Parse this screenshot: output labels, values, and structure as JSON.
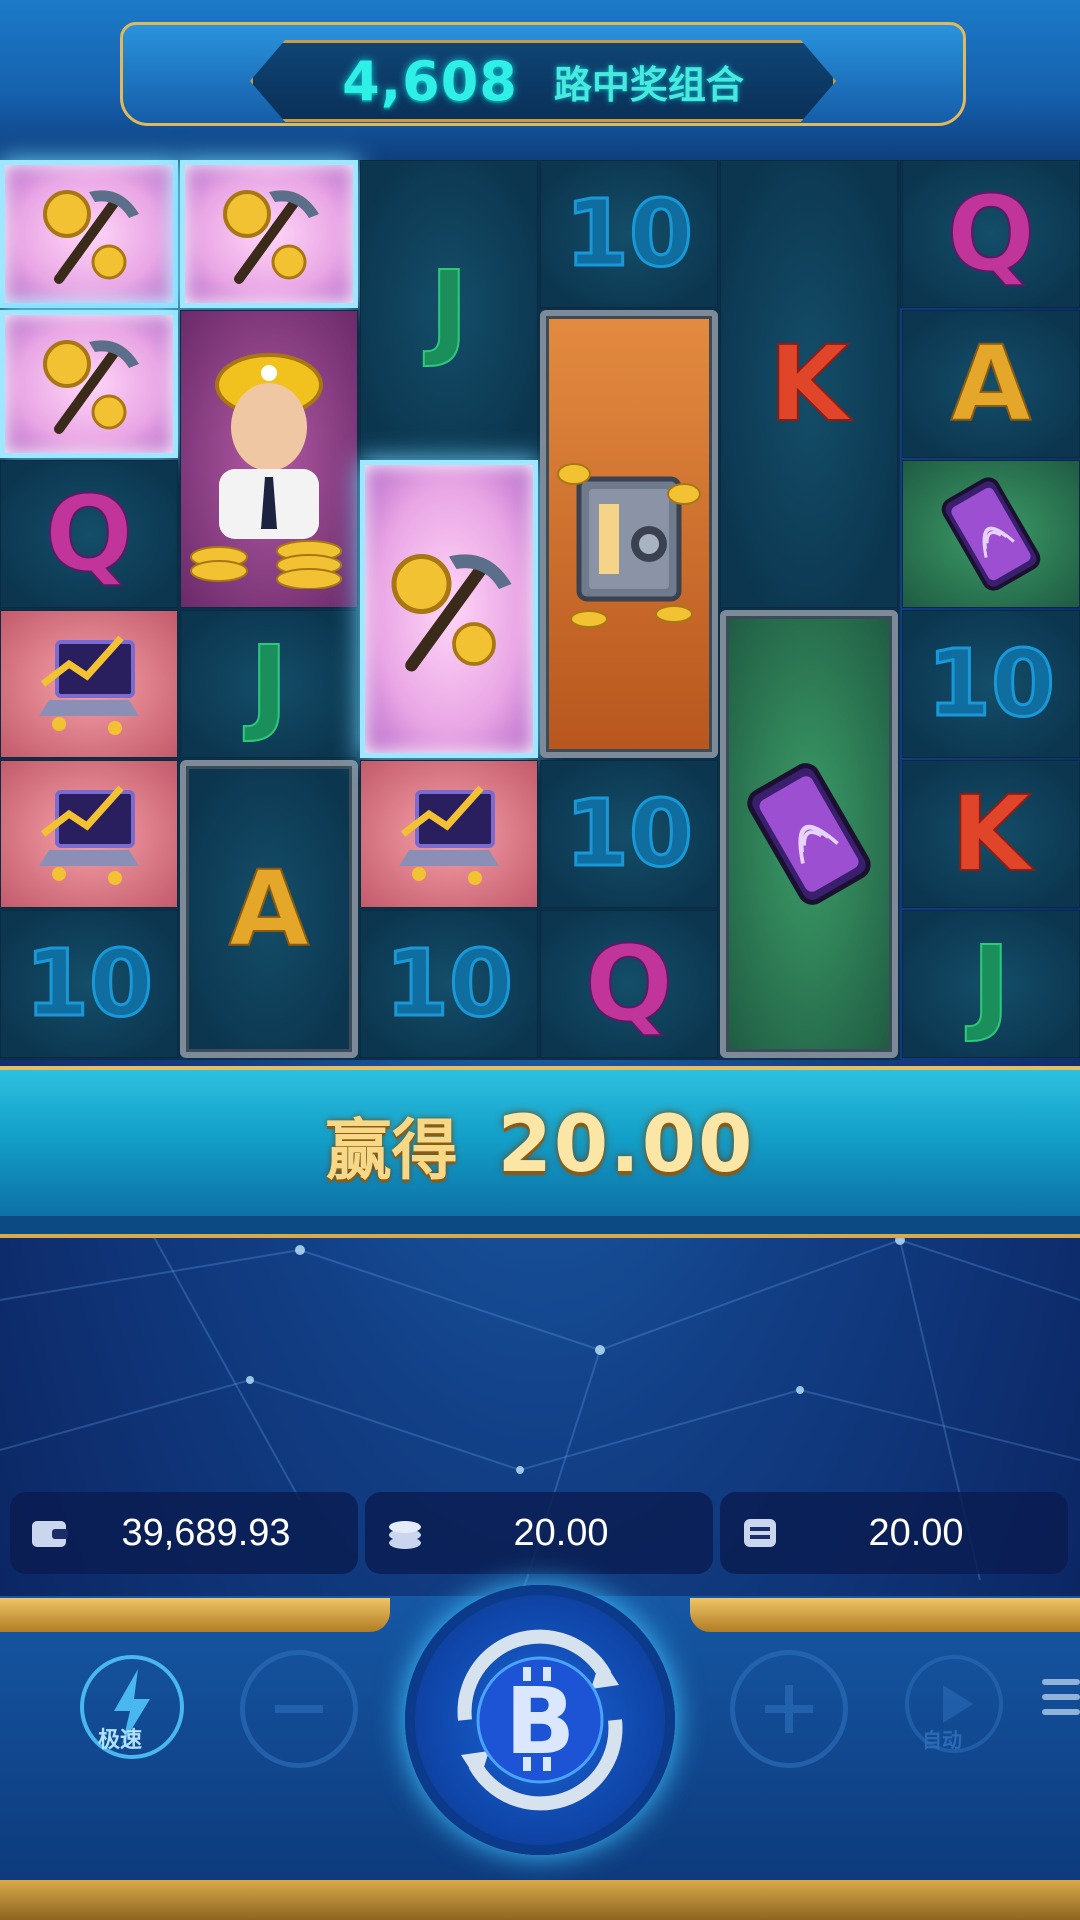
{
  "header": {
    "ways_count": "4,608",
    "ways_label": "路中奖组合"
  },
  "grid": {
    "reel1": [
      "pickaxe-coins",
      "pickaxe-coins",
      "Q",
      "laptop",
      "laptop",
      "10"
    ],
    "reel2": [
      "pickaxe-coins",
      "miner",
      "J",
      "A"
    ],
    "reel3": [
      "J",
      "pickaxe-coins",
      "laptop",
      "10"
    ],
    "reel4": [
      "10",
      "safe",
      "10",
      "Q"
    ],
    "reel5": [
      "K",
      "phone"
    ],
    "reel6": [
      "Q",
      "A",
      "phone",
      "10",
      "K",
      "J"
    ]
  },
  "win": {
    "label": "赢得",
    "amount": "20.00"
  },
  "info": {
    "balance": "39,689.93",
    "bet": "20.00",
    "win": "20.00"
  },
  "controls": {
    "turbo_label": "极速",
    "auto_label": "自动"
  },
  "colors": {
    "accent_gold": "#d8aa4a",
    "ways_cyan": "#2ff0e6",
    "background_blue": "#123f86"
  }
}
